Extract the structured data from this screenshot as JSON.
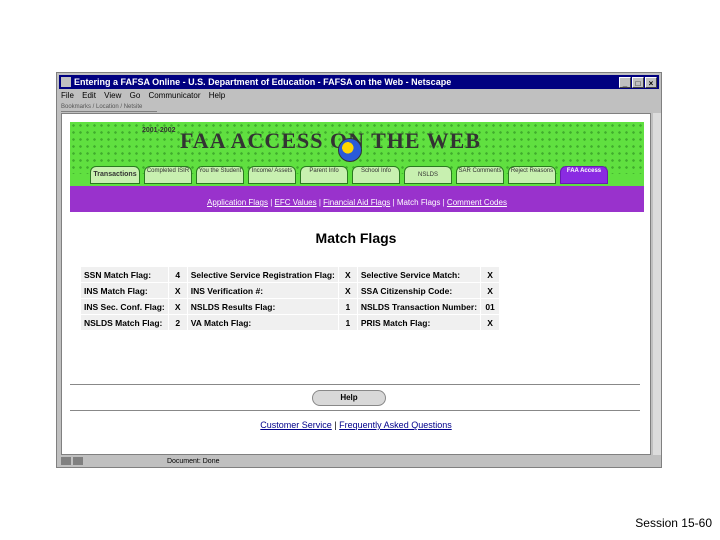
{
  "window": {
    "title": "Entering a FAFSA Online - U.S. Department of Education - FAFSA on the Web - Netscape",
    "controls": [
      "_",
      "□",
      "×"
    ]
  },
  "menu": [
    "File",
    "Edit",
    "View",
    "Go",
    "Communicator",
    "Help"
  ],
  "toolbar_strip": "Bookmarks / Location / Netsite",
  "banner": {
    "year": "2001-2002",
    "logo": "FAA ACCESS ON THE WEB",
    "tabs": [
      {
        "label": "Transactions"
      },
      {
        "label": "Completed ISIR"
      },
      {
        "label": "You the Student"
      },
      {
        "label": "Income/ Assets"
      },
      {
        "label": "Parent Info"
      },
      {
        "label": "School Info"
      },
      {
        "label": "NSLDS"
      },
      {
        "label": "SAR Comments"
      },
      {
        "label": "Reject Reasons"
      },
      {
        "label": "FAA Access"
      }
    ]
  },
  "subnav": [
    "Application Flags",
    "EFC Values",
    "Financial Aid Flags",
    "Match Flags",
    "Comment Codes"
  ],
  "page_title": "Match Flags",
  "flags": [
    [
      {
        "label": "SSN Match Flag:",
        "value": "4"
      },
      {
        "label": "Selective Service Registration Flag:",
        "value": "X"
      },
      {
        "label": "Selective Service Match:",
        "value": "X"
      }
    ],
    [
      {
        "label": "INS Match Flag:",
        "value": "X"
      },
      {
        "label": "INS Verification #:",
        "value": "X"
      },
      {
        "label": "SSA Citizenship Code:",
        "value": "X"
      }
    ],
    [
      {
        "label": "INS Sec. Conf. Flag:",
        "value": "X"
      },
      {
        "label": "NSLDS Results Flag:",
        "value": "1"
      },
      {
        "label": "NSLDS Transaction Number:",
        "value": "01"
      }
    ],
    [
      {
        "label": "NSLDS Match Flag:",
        "value": "2"
      },
      {
        "label": "VA Match Flag:",
        "value": "1"
      },
      {
        "label": "PRIS Match Flag:",
        "value": "X"
      }
    ]
  ],
  "help_button": "Help",
  "footer_links": [
    "Customer Service",
    "Frequently Asked Questions"
  ],
  "status": "Document: Done",
  "session_label": "Session 15-60"
}
